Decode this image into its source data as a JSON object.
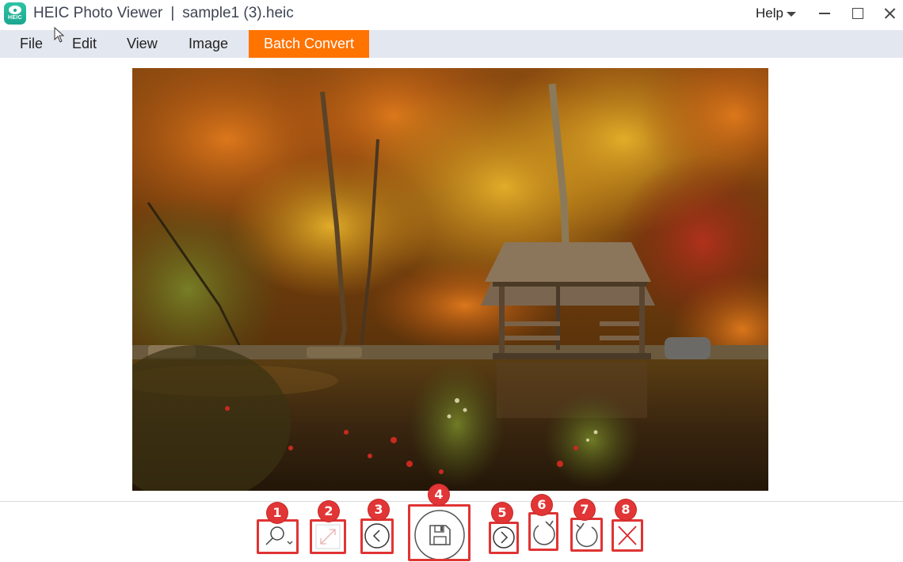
{
  "titlebar": {
    "app_icon_label": "HEIC",
    "app_name": "HEIC Photo Viewer",
    "separator": "|",
    "file_name": "sample1 (3).heic",
    "help_label": "Help"
  },
  "menubar": {
    "items": [
      {
        "label": "File"
      },
      {
        "label": "Edit"
      },
      {
        "label": "View"
      },
      {
        "label": "Image"
      },
      {
        "label": "Batch Convert",
        "highlighted": true
      }
    ],
    "accent_color": "#ff7300"
  },
  "viewer": {
    "image_description": "Autumn forest with a wooden gazebo by a pond"
  },
  "toolbar": {
    "annotation_color": "#e23535",
    "tools": [
      {
        "badge": "1",
        "icon": "zoom-dropdown-icon",
        "name": "Zoom"
      },
      {
        "badge": "2",
        "icon": "fit-to-screen-icon",
        "name": "Fit / Actual size",
        "disabled": true
      },
      {
        "badge": "3",
        "icon": "previous-icon",
        "name": "Previous"
      },
      {
        "badge": "4",
        "icon": "save-icon",
        "name": "Save"
      },
      {
        "badge": "5",
        "icon": "next-icon",
        "name": "Next"
      },
      {
        "badge": "6",
        "icon": "rotate-left-icon",
        "name": "Rotate left"
      },
      {
        "badge": "7",
        "icon": "rotate-right-icon",
        "name": "Rotate right"
      },
      {
        "badge": "8",
        "icon": "delete-icon",
        "name": "Delete"
      }
    ]
  }
}
